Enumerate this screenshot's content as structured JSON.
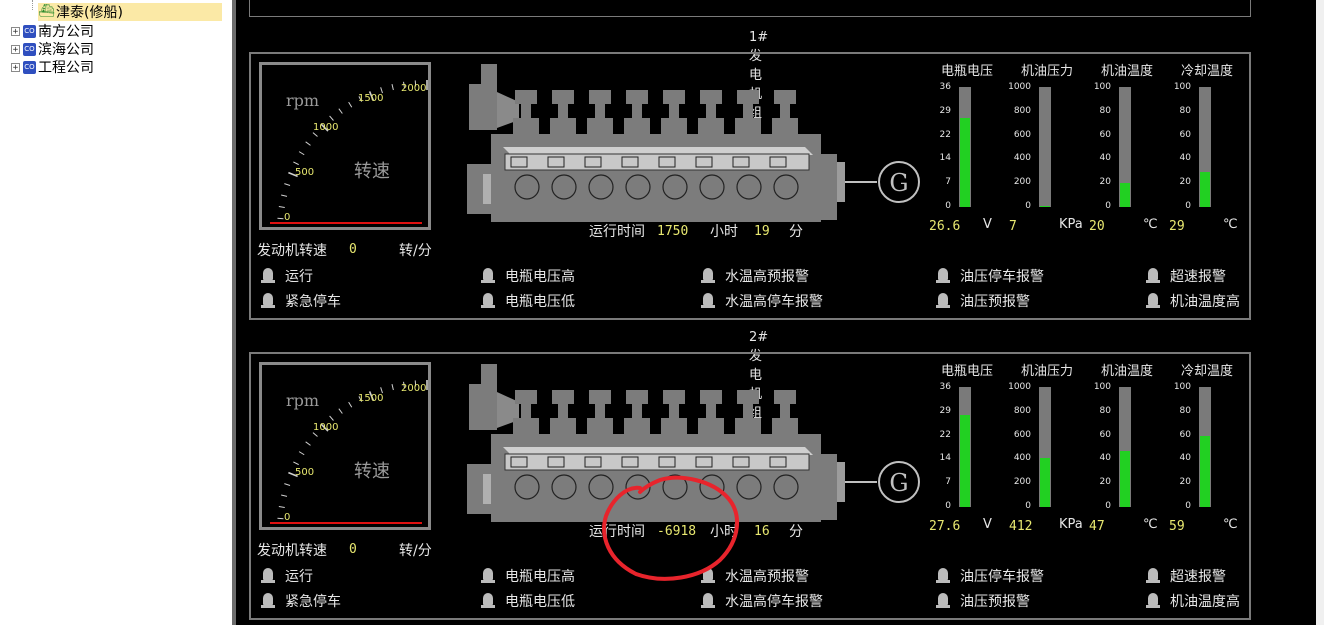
{
  "tree": {
    "items": [
      {
        "label": "津泰(修船)",
        "selected": true
      },
      {
        "label": "南方公司"
      },
      {
        "label": "滨海公司"
      },
      {
        "label": "工程公司"
      }
    ],
    "company_icon_text": "CO",
    "expander_symbol": "+"
  },
  "gauge": {
    "rpm_label": "rpm",
    "speed_text": "转速",
    "ticks": [
      "0",
      "500",
      "1000",
      "1500",
      "2000"
    ]
  },
  "labels": {
    "engine_speed": "发动机转速",
    "speed_unit": "转/分",
    "run_time": "运行时间",
    "hours": "小时",
    "minutes": "分",
    "generator_symbol": "G"
  },
  "indicators": {
    "names": [
      "电瓶电压",
      "机油压力",
      "机油温度",
      "冷却温度"
    ],
    "units": [
      "V",
      "KPa",
      "℃",
      "℃"
    ],
    "scales": [
      [
        "36",
        "29",
        "22",
        "14",
        "7",
        "0"
      ],
      [
        "1000",
        "800",
        "600",
        "400",
        "200",
        "0"
      ],
      [
        "100",
        "80",
        "60",
        "40",
        "20",
        "0"
      ],
      [
        "100",
        "80",
        "60",
        "40",
        "20",
        "0"
      ]
    ],
    "max": [
      36,
      1000,
      100,
      100
    ]
  },
  "alarms": [
    "运行",
    "紧急停车",
    "电瓶电压高",
    "电瓶电压低",
    "水温高预报警",
    "水温高停车报警",
    "油压停车报警",
    "油压预报警",
    "超速报警",
    "机油温度高"
  ],
  "generators": [
    {
      "title": "1#发电机组",
      "engine_speed": "0",
      "run_hours": "1750",
      "run_minutes": "19",
      "readings": [
        "26.6",
        "7",
        "20",
        "29"
      ],
      "levels": [
        26.6,
        7,
        20,
        29
      ]
    },
    {
      "title": "2#发电机组",
      "engine_speed": "0",
      "run_hours": "-6918",
      "run_minutes": "16",
      "readings": [
        "27.6",
        "412",
        "47",
        "59"
      ],
      "levels": [
        27.6,
        412,
        47,
        59
      ]
    }
  ],
  "colors": {
    "background": "#000000",
    "panel_border": "#7a7a7a",
    "bar_fill": "#22d022",
    "value_text": "#e8e870",
    "needle_line": "#e01010",
    "annotation": "#e8242c"
  }
}
